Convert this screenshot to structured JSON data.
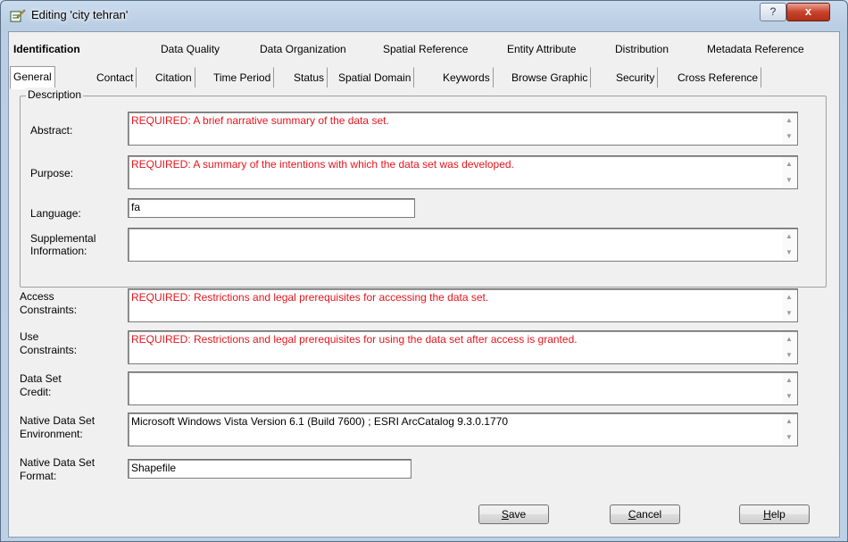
{
  "window": {
    "title": "Editing 'city tehran'",
    "help_label": "?",
    "close_label": "x"
  },
  "top_tabs": [
    "Identification",
    "Data Quality",
    "Data Organization",
    "Spatial Reference",
    "Entity Attribute",
    "Distribution",
    "Metadata Reference"
  ],
  "sub_tabs": [
    "General",
    "Contact",
    "Citation",
    "Time Period",
    "Status",
    "Spatial Domain",
    "Keywords",
    "Browse Graphic",
    "Security",
    "Cross Reference"
  ],
  "description": {
    "legend": "Description",
    "abstract_label": "Abstract:",
    "abstract_value": "REQUIRED: A brief narrative summary of the data set.",
    "purpose_label": "Purpose:",
    "purpose_value": "REQUIRED: A summary of the intentions with which the data set was developed.",
    "language_label": "Language:",
    "language_value": "fa",
    "supplemental_label_1": "Supplemental",
    "supplemental_label_2": "Information:",
    "supplemental_value": ""
  },
  "fields": {
    "access_label_1": "Access",
    "access_label_2": "Constraints:",
    "access_value": "REQUIRED: Restrictions and legal prerequisites for accessing the data set.",
    "use_label_1": "Use",
    "use_label_2": "Constraints:",
    "use_value": "REQUIRED: Restrictions and legal prerequisites for using the data set after access is granted.",
    "credit_label_1": "Data Set",
    "credit_label_2": "Credit:",
    "credit_value": "",
    "env_label_1": "Native Data Set",
    "env_label_2": "Environment:",
    "env_value": "Microsoft Windows Vista Version 6.1 (Build 7600) ; ESRI ArcCatalog 9.3.0.1770",
    "format_label_1": "Native Data Set",
    "format_label_2": "Format:",
    "format_value": "Shapefile"
  },
  "buttons": {
    "save_first": "S",
    "save_rest": "ave",
    "cancel_first": "C",
    "cancel_rest": "ancel",
    "help_first": "H",
    "help_rest": "elp"
  },
  "colors": {
    "required_text": "#e8141c",
    "window_frame": "#bcd0e6"
  },
  "icons": {
    "title": "edit-pencil-icon",
    "scroll_up": "scroll-up-arrow-icon",
    "scroll_down": "scroll-down-arrow-icon"
  }
}
